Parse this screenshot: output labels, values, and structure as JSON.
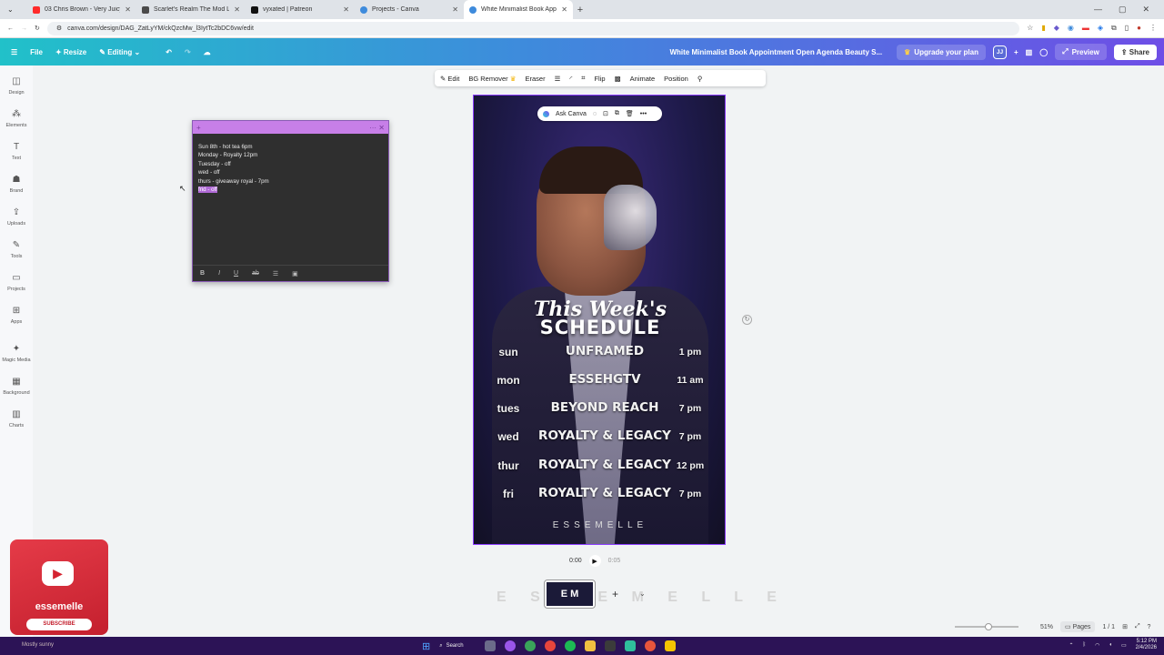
{
  "browser": {
    "tabs": [
      {
        "title": "03 Chris Brown - Very Juicy",
        "color": "#ff2a2a"
      },
      {
        "title": "Scarlet's Realm The Mod List [Sim",
        "color": "#4a4a4a"
      },
      {
        "title": "vyxated | Patreon",
        "color": "#111111"
      },
      {
        "title": "Projects - Canva",
        "color": "#3e8bdc"
      },
      {
        "title": "White Minimalist Book Appoin",
        "color": "#3e8bdc"
      }
    ],
    "url": "canva.com/design/DAG_ZatLyYM/ckQzcMw_l3IytTc2bDC6vw/edit"
  },
  "toolbar": {
    "file": "File",
    "resize": "Resize",
    "editing": "Editing",
    "title": "White Minimalist Book Appointment Open Agenda Beauty S...",
    "upgrade": "Upgrade your plan",
    "avatar": "JJ",
    "preview": "Preview",
    "share": "Share"
  },
  "sidebar": [
    {
      "label": "Design",
      "icon": "◫"
    },
    {
      "label": "Elements",
      "icon": "⁂"
    },
    {
      "label": "Text",
      "icon": "T"
    },
    {
      "label": "Brand",
      "icon": "☗"
    },
    {
      "label": "Uploads",
      "icon": "⇪"
    },
    {
      "label": "Tools",
      "icon": "✎"
    },
    {
      "label": "Projects",
      "icon": "▭"
    },
    {
      "label": "Apps",
      "icon": "⊞"
    },
    {
      "label": "Magic Media",
      "icon": "✦"
    },
    {
      "label": "Background",
      "icon": "▦"
    },
    {
      "label": "Charts",
      "icon": "▥"
    }
  ],
  "context_toolbar": {
    "edit": "Edit",
    "bg_remover": "BG Remover",
    "eraser": "Eraser",
    "flip": "Flip",
    "animate": "Animate",
    "position": "Position"
  },
  "ask_canva": "Ask Canva",
  "sticky_note": {
    "lines": [
      "Sun 8th - hot tea 6pm",
      "Monday - Royalty  12pm",
      "Tuesday - off",
      "wed - off",
      "thurs - giveaway royal - 7pm"
    ],
    "selected_line": "frid - off"
  },
  "design": {
    "title_line1": "This Week's",
    "title_line2": "SCHEDULE",
    "schedule": [
      {
        "day": "sun",
        "show": "UNFRAMED",
        "time": "1 pm"
      },
      {
        "day": "mon",
        "show": "ESSEHGTV",
        "time": "11 am"
      },
      {
        "day": "tues",
        "show": "BEYOND REACH",
        "time": "7 pm"
      },
      {
        "day": "wed",
        "show": "ROYALTY & LEGACY",
        "time": "7 pm"
      },
      {
        "day": "thur",
        "show": "ROYALTY & LEGACY",
        "time": "12 pm"
      },
      {
        "day": "fri",
        "show": "ROYALTY & LEGACY",
        "time": "7 pm"
      }
    ],
    "brand": "ESSEMELLE"
  },
  "player": {
    "current": "0:00",
    "duration": "0:05"
  },
  "page_thumb": "E M",
  "ghost_text": "E S S E M E L L E",
  "footer": {
    "zoom": "51%",
    "pages_label": "Pages",
    "page_count": "1 / 1"
  },
  "overlay": {
    "channel": "essemelle",
    "subscribe": "SUBSCRIBE"
  },
  "taskbar": {
    "left_text": "Mostly sunny",
    "search": "Search",
    "time": "5:12 PM",
    "date": "2/4/2026"
  }
}
